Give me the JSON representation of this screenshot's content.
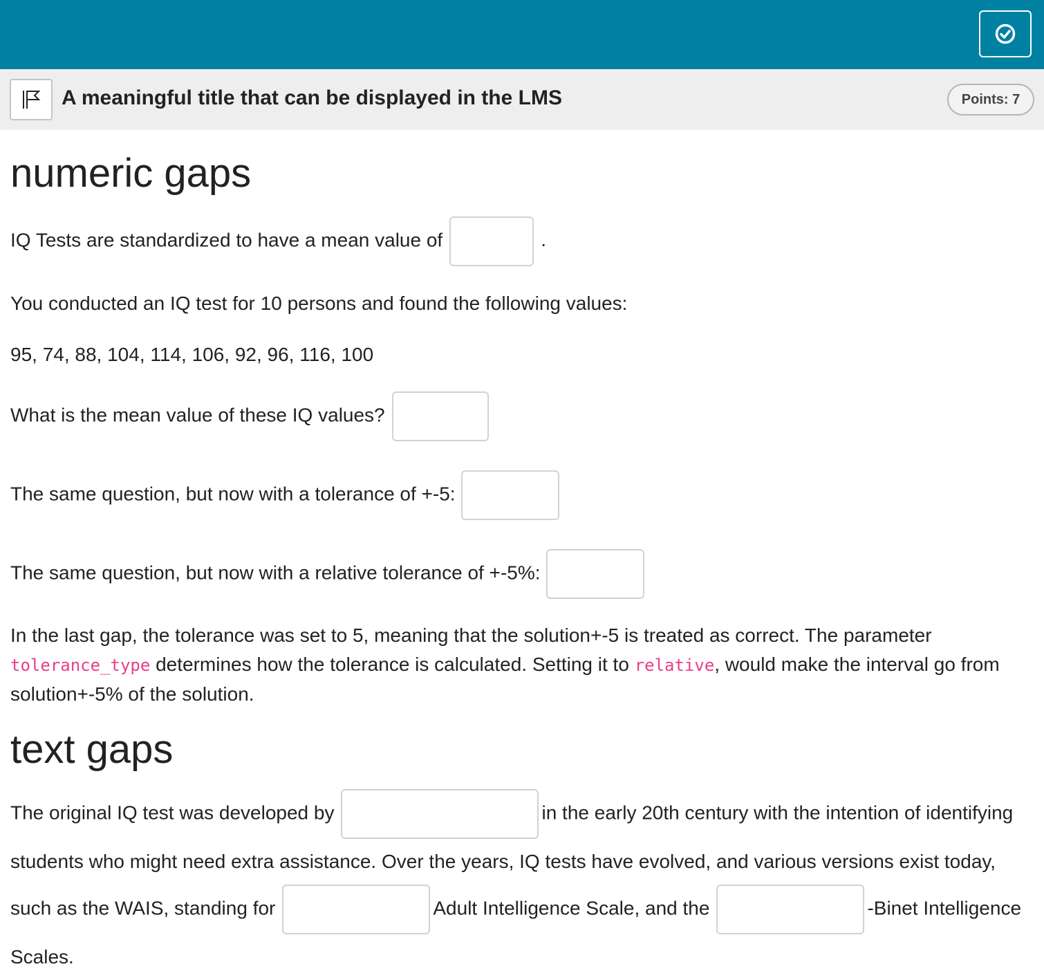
{
  "header": {
    "check_icon": "check-circle-icon",
    "flag_icon": "flag-icon",
    "title": "A meaningful title that can be displayed in the LMS",
    "points": "Points: 7",
    "bar_color": "#0081a1"
  },
  "numeric": {
    "heading": "numeric gaps",
    "q1_text": "IQ Tests are standardized to have a mean value of",
    "q1_after": ".",
    "intro": "You conducted an IQ test for 10 persons and found the following values:",
    "values": "95, 74, 88, 104, 114, 106, 92, 96, 116, 100",
    "q2_text": "What is the mean value of these IQ values?",
    "q3_text": "The same question, but now with a tolerance of +-5:",
    "q4_text": "The same question, but now with a relative tolerance of +-5%:",
    "note_part1": "In the last gap, the tolerance was set to 5, meaning that the solution+-5 is treated as correct. The parameter",
    "note_code1": "tolerance_type",
    "note_part2": "determines how the tolerance is calculated. Setting it to",
    "note_code2": "relative",
    "note_part3": ", would make the interval go from solution+-5% of the solution."
  },
  "text_gaps": {
    "heading": "text gaps",
    "s1": "The original IQ test was developed by",
    "s2": "in the early 20th century with the intention of identifying students who might need extra assistance. Over the years, IQ tests have evolved, and various versions exist today, such as the WAIS, standing for",
    "s3": "Adult Intelligence Scale, and the",
    "s4": "-Binet Intelligence Scales."
  },
  "gaps": {
    "q1": "",
    "q2": "",
    "q3": "",
    "q4": "",
    "t1": "",
    "t2": "",
    "t3": ""
  }
}
